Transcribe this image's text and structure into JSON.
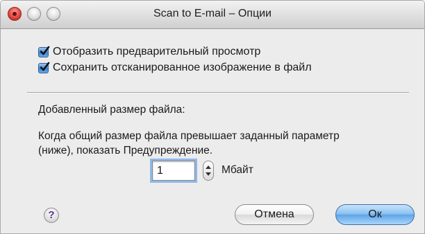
{
  "window": {
    "title": "Scan to E-mail – Опции"
  },
  "options": {
    "show_preview": {
      "label": "Отобразить предварительный просмотр",
      "checked": true
    },
    "save_to_file": {
      "label": "Сохранить отсканированное изображение в файл",
      "checked": true
    }
  },
  "attachment": {
    "heading": "Добавленный размер файла:",
    "description_line1": "Когда общий размер файла превышает заданный параметр",
    "description_line2": "(ниже), показать Предупреждение.",
    "size_value": "1",
    "unit": "Мбайт"
  },
  "footer": {
    "help_symbol": "?",
    "cancel_label": "Отмена",
    "ok_label": "Ок"
  },
  "colors": {
    "accent": "#5fa5e8",
    "close_button": "#e2473d"
  }
}
